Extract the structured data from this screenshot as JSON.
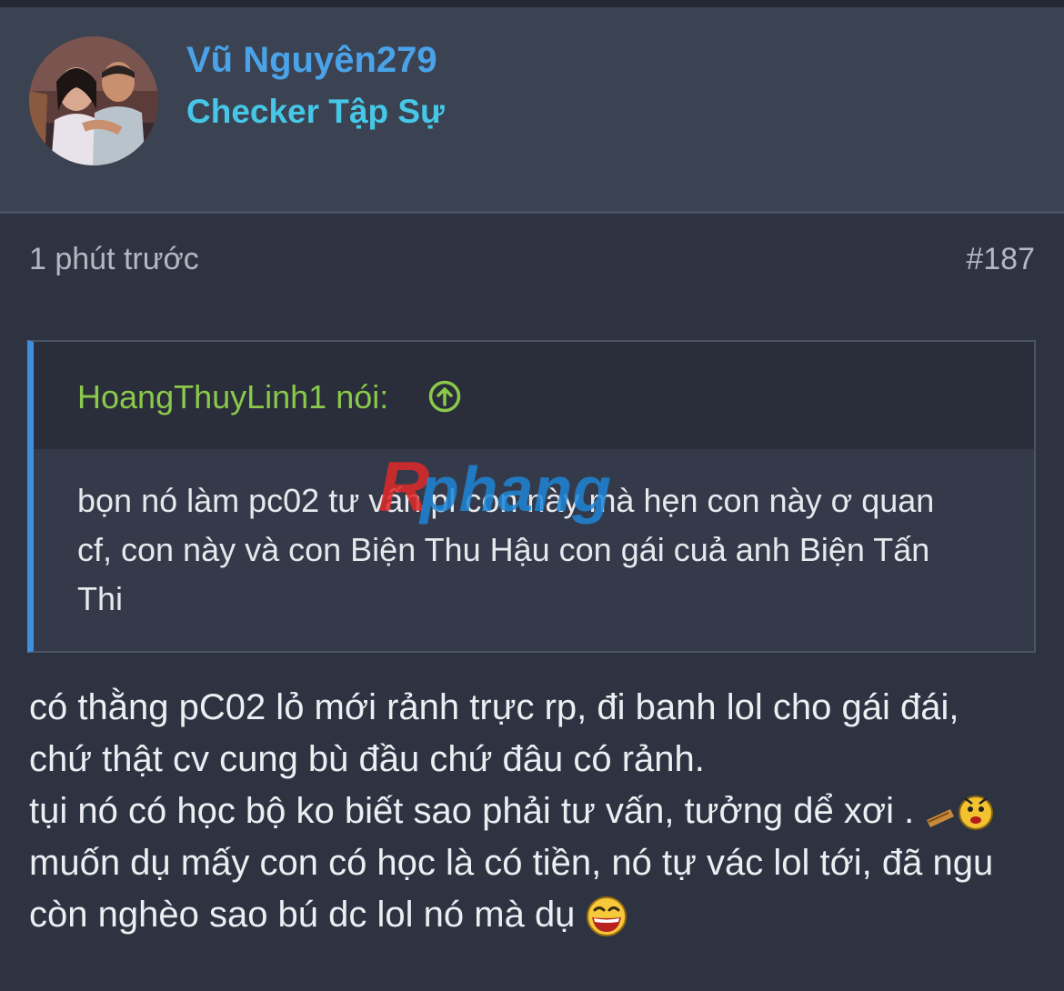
{
  "post": {
    "username": "Vũ Nguyên279",
    "user_title": "Checker Tập Sự",
    "avatar": "avatar-photo",
    "time": "1 phút trước",
    "number": "#187"
  },
  "quote": {
    "author": "HoangThuyLinh1 nói:",
    "arrow_icon": "arrow-up-circle-icon",
    "lines": [
      "bọn nó làm pc02 tư vấn pl con này mà hẹn con này ơ quan",
      "cf, con này và con Biện Thu Hậu con gái cuả anh Biện Tấn",
      "Thi"
    ]
  },
  "watermark": {
    "text": "Rphang",
    "colors": [
      "#e02a2a",
      "#1e86d6"
    ]
  },
  "message": {
    "lines": [
      "có thằng pC02 lỏ mới rảnh trực rp, đi banh lol cho gái đái,",
      "chứ thật cv cung bù đầu chứ đâu có rảnh.",
      "tụi nó có học bộ ko biết sao phải tư vấn, tưởng dể xơi .",
      "muốn dụ mấy con có học là có tiền, nó tự vác lol tới, đã ngu",
      "còn nghèo sao bú dc lol nó mà dụ"
    ],
    "emoji_icons": [
      "angry-emoji-icon",
      "laughing-emoji-icon"
    ]
  },
  "colors": {
    "background": "#2d3341",
    "card": "#3b4252",
    "username": "#4aa3e8",
    "user_title": "#46c7e8",
    "quote_author": "#8bc94b",
    "quote_bar": "#3d8fe0"
  }
}
